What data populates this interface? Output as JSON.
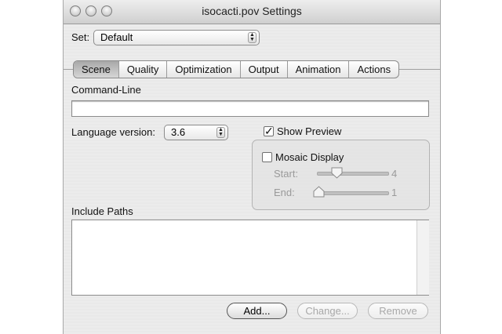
{
  "window": {
    "title": "isocacti.pov Settings"
  },
  "set": {
    "label": "Set:",
    "value": "Default"
  },
  "tabs": [
    {
      "label": "Scene",
      "active": true
    },
    {
      "label": "Quality",
      "active": false
    },
    {
      "label": "Optimization",
      "active": false
    },
    {
      "label": "Output",
      "active": false
    },
    {
      "label": "Animation",
      "active": false
    },
    {
      "label": "Actions",
      "active": false
    }
  ],
  "command_line": {
    "label": "Command-Line",
    "value": ""
  },
  "language": {
    "label": "Language version:",
    "value": "3.6"
  },
  "preview": {
    "show_label": "Show Preview",
    "show_checked": true,
    "mosaic_label": "Mosaic Display",
    "mosaic_checked": false,
    "start_label": "Start:",
    "start_value": "4",
    "end_label": "End:",
    "end_value": "1"
  },
  "include_paths": {
    "label": "Include Paths",
    "items": []
  },
  "buttons": {
    "add": "Add...",
    "change": "Change...",
    "remove": "Remove"
  }
}
